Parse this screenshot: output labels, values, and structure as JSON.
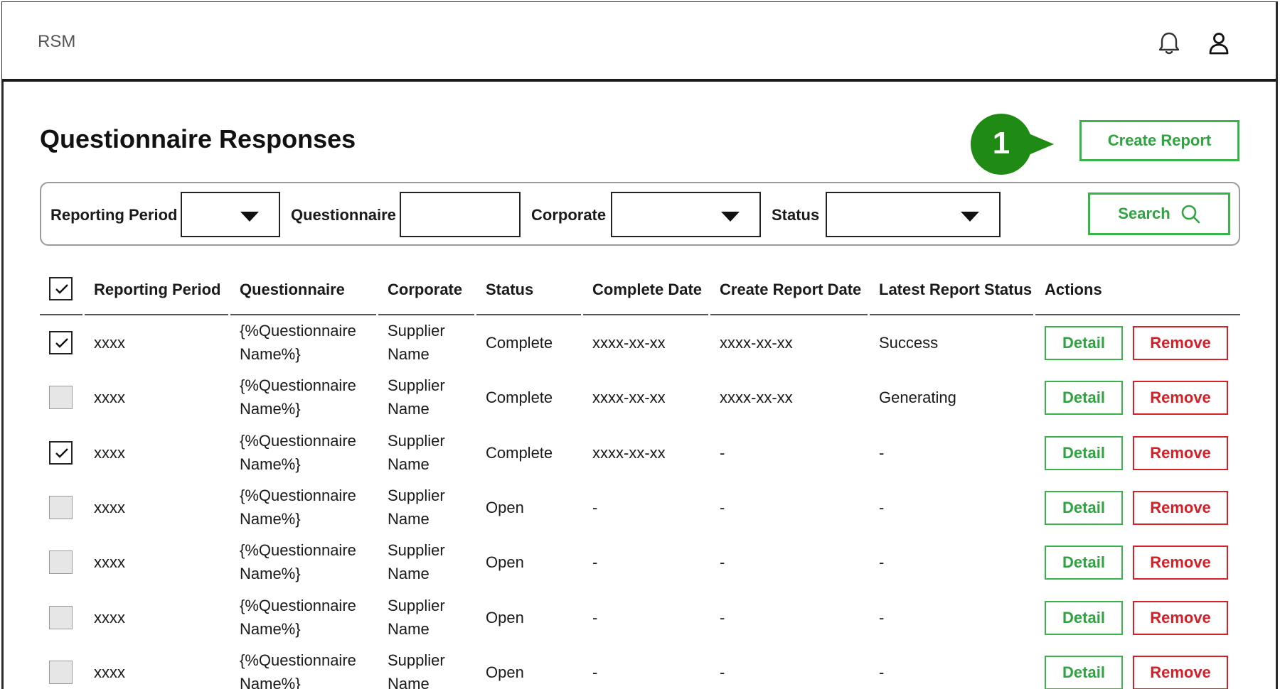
{
  "app": {
    "brand": "RSM"
  },
  "header_icons": [
    "bell-icon",
    "user-icon"
  ],
  "page": {
    "title": "Questionnaire Responses"
  },
  "annotation": {
    "marker_number": "1"
  },
  "actions": {
    "create_report": "Create Report",
    "search": "Search"
  },
  "filters": {
    "reporting_period": {
      "label": "Reporting Period",
      "value": ""
    },
    "questionnaire": {
      "label": "Questionnaire",
      "value": ""
    },
    "corporate": {
      "label": "Corporate",
      "value": ""
    },
    "status": {
      "label": "Status",
      "value": ""
    }
  },
  "table": {
    "header_checkbox_checked": true,
    "columns": [
      "Reporting Period",
      "Questionnaire",
      "Corporate",
      "Status",
      "Complete Date",
      "Create Report Date",
      "Latest Report Status",
      "Actions"
    ],
    "row_actions": {
      "detail": "Detail",
      "remove": "Remove"
    },
    "rows": [
      {
        "checked": true,
        "period": "xxxx",
        "q_line1": "{%Questionnaire",
        "q_line2": "Name%}",
        "corp_line1": "Supplier",
        "corp_line2": "Name",
        "status": "Complete",
        "complete_date": "xxxx-xx-xx",
        "create_report_date": "xxxx-xx-xx",
        "latest_report_status": "Success"
      },
      {
        "checked": false,
        "period": "xxxx",
        "q_line1": "{%Questionnaire",
        "q_line2": "Name%}",
        "corp_line1": "Supplier",
        "corp_line2": "Name",
        "status": "Complete",
        "complete_date": "xxxx-xx-xx",
        "create_report_date": "xxxx-xx-xx",
        "latest_report_status": "Generating"
      },
      {
        "checked": true,
        "period": "xxxx",
        "q_line1": "{%Questionnaire",
        "q_line2": "Name%}",
        "corp_line1": "Supplier",
        "corp_line2": "Name",
        "status": "Complete",
        "complete_date": "xxxx-xx-xx",
        "create_report_date": "-",
        "latest_report_status": "-"
      },
      {
        "checked": false,
        "period": "xxxx",
        "q_line1": "{%Questionnaire",
        "q_line2": "Name%}",
        "corp_line1": "Supplier",
        "corp_line2": "Name",
        "status": "Open",
        "complete_date": "-",
        "create_report_date": "-",
        "latest_report_status": "-"
      },
      {
        "checked": false,
        "period": "xxxx",
        "q_line1": "{%Questionnaire",
        "q_line2": "Name%}",
        "corp_line1": "Supplier",
        "corp_line2": "Name",
        "status": "Open",
        "complete_date": "-",
        "create_report_date": "-",
        "latest_report_status": "-"
      },
      {
        "checked": false,
        "period": "xxxx",
        "q_line1": "{%Questionnaire",
        "q_line2": "Name%}",
        "corp_line1": "Supplier",
        "corp_line2": "Name",
        "status": "Open",
        "complete_date": "-",
        "create_report_date": "-",
        "latest_report_status": "-"
      },
      {
        "checked": false,
        "period": "xxxx",
        "q_line1": "{%Questionnaire",
        "q_line2": "Name%}",
        "corp_line1": "Supplier",
        "corp_line2": "Name",
        "status": "Open",
        "complete_date": "-",
        "create_report_date": "-",
        "latest_report_status": "-"
      }
    ]
  },
  "colors": {
    "accent_green": "#38b54a",
    "marker_green": "#1f8a14",
    "remove_red": "#d61f26"
  }
}
